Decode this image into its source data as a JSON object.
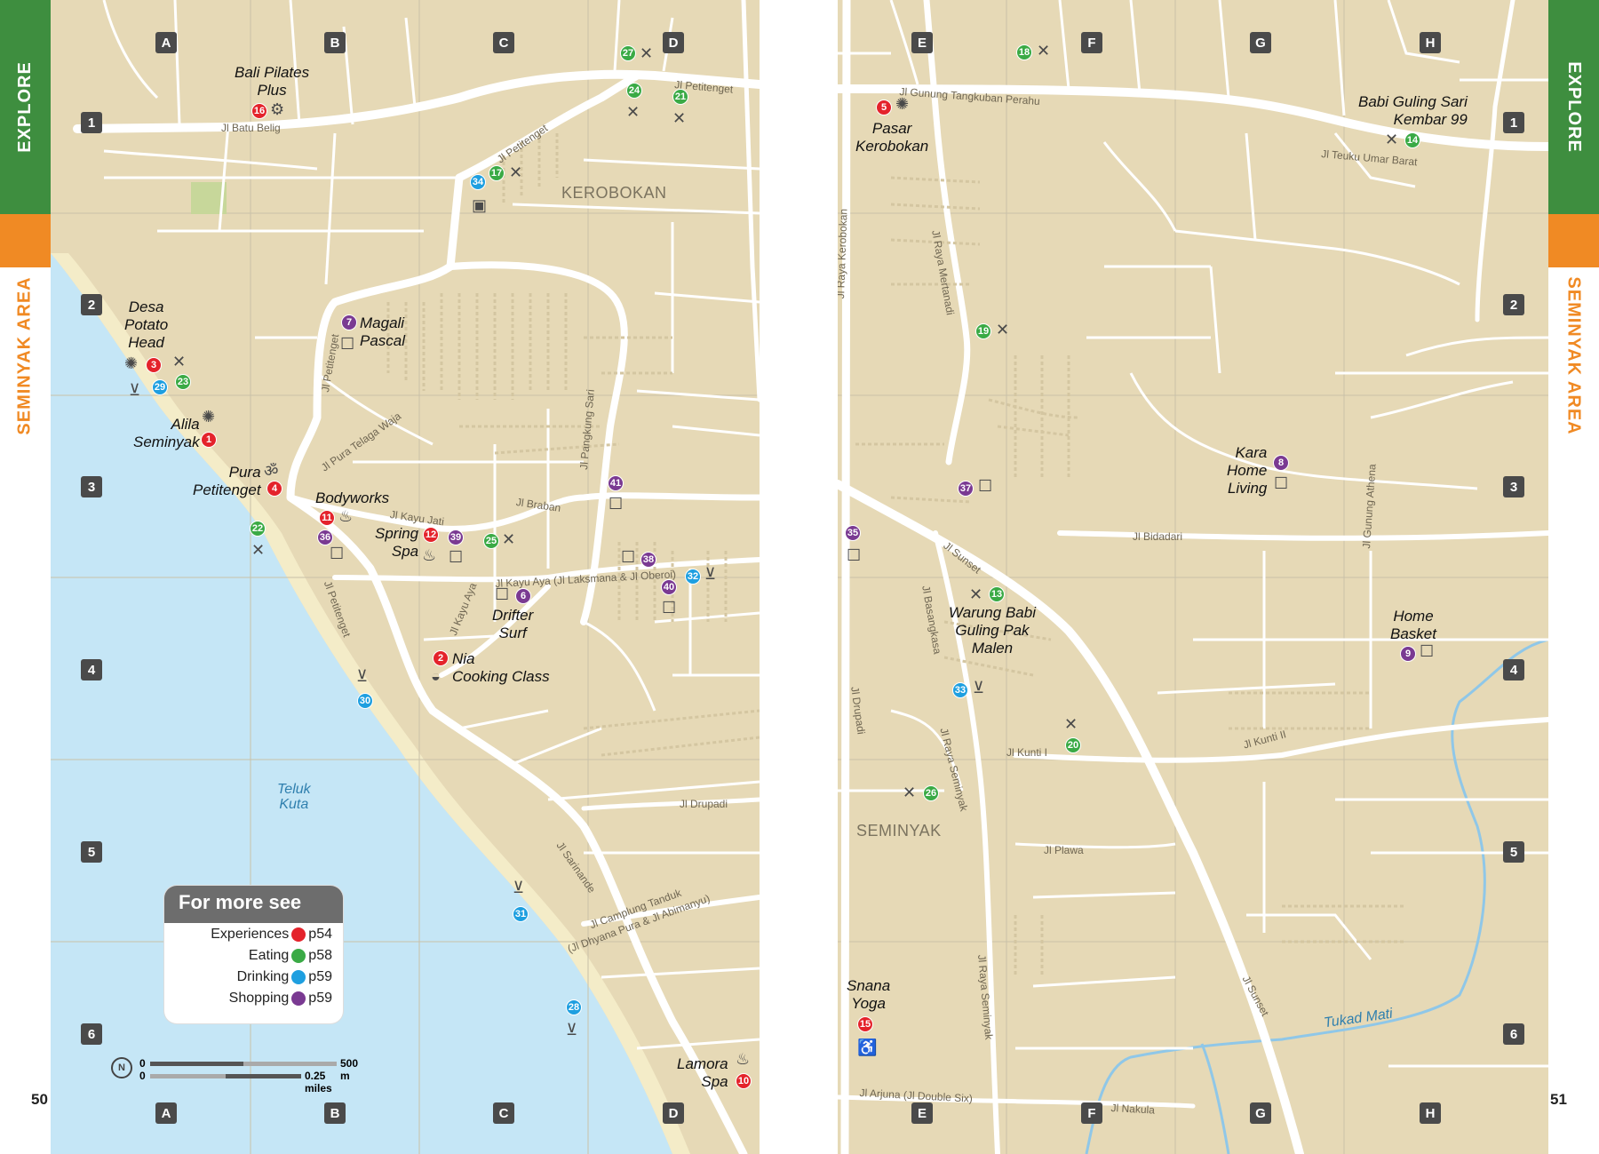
{
  "tabs": {
    "left_explore": "EXPLORE",
    "left_area": "SEMINYAK AREA",
    "right_explore": "EXPLORE",
    "right_area": "SEMINYAK AREA"
  },
  "page_numbers": {
    "left": "50",
    "right": "51"
  },
  "grid": {
    "left_cols": [
      "A",
      "B",
      "C",
      "D"
    ],
    "right_cols": [
      "E",
      "F",
      "G",
      "H"
    ],
    "rows": [
      "1",
      "2",
      "3",
      "4",
      "5",
      "6"
    ]
  },
  "area_labels": {
    "kerobokan": "KEROBOKAN",
    "seminyak": "SEMINYAK"
  },
  "water": {
    "teluk_kuta": "Teluk\nKuta",
    "tukad_mati": "Tukad Mati"
  },
  "streets": {
    "jl_batu_belig": "Jl Batu Belig",
    "jl_petitenget_top": "Jl Petitenget",
    "jl_petitenget_mid": "Jl Petitenget",
    "jl_petitenget_c2": "Jl Petitenget",
    "jl_petitenget_b4": "Jl Petitenget",
    "jl_pura_telaga_waja": "Jl Pura Telaga Waja",
    "jl_kayu_jati": "Jl Kayu Jati",
    "jl_braban": "Jl Braban",
    "jl_pangkung_sari": "Jl Pangkung Sari",
    "jl_kayu_aya_long": "Jl Kayu Aya (Jl Laksmana & Jl Oberoi)",
    "jl_kayu_aya": "Jl Kayu Aya",
    "jl_drupadi_left": "Jl Drupadi",
    "jl_sarinande": "Jl Sarinande",
    "jl_camplung": "Jl Camplung Tanduk",
    "jl_camplung2": "(Jl Dhyana Pura & Jl Abimanyu)",
    "jl_gunung_tangkuban": "Jl Gunung Tangkuban Perahu",
    "jl_teuku_umar": "Jl Teuku Umar Barat",
    "jl_raya_kerobokan": "Jl Raya Kerobokan",
    "jl_raya_mertanadi": "Jl Raya Mertanadi",
    "jl_sunset": "Jl Sunset",
    "jl_sunset2": "Jl Sunset",
    "jl_bidadari": "Jl Bidadari",
    "jl_gunung_athena": "Jl Gunung Athena",
    "jl_basangkasa": "Jl Basangkasa",
    "jl_drupadi_right": "Jl Drupadi",
    "jl_raya_seminyak": "Jl Raya Seminyak",
    "jl_raya_seminyak2": "Jl Raya Seminyak",
    "jl_kunti1": "Jl Kunti I",
    "jl_kunti2": "Jl Kunti II",
    "jl_plawa": "Jl Plawa",
    "jl_arjuna": "Jl Arjuna (Jl Double Six)",
    "jl_nakula": "Jl Nakula"
  },
  "places": [
    {
      "num": "16",
      "cat": "red",
      "label": "Bali Pilates\nPlus"
    },
    {
      "num": "27",
      "cat": "green",
      "label": ""
    },
    {
      "num": "24",
      "cat": "green",
      "label": ""
    },
    {
      "num": "21",
      "cat": "green",
      "label": ""
    },
    {
      "num": "17",
      "cat": "green",
      "label": ""
    },
    {
      "num": "34",
      "cat": "blue",
      "label": ""
    },
    {
      "num": "3",
      "cat": "red",
      "label": "Desa\nPotato\nHead"
    },
    {
      "num": "29",
      "cat": "blue",
      "label": ""
    },
    {
      "num": "23",
      "cat": "green",
      "label": ""
    },
    {
      "num": "7",
      "cat": "purple",
      "label": "Magali\nPascal"
    },
    {
      "num": "1",
      "cat": "red",
      "label": "Alila\nSeminyak"
    },
    {
      "num": "4",
      "cat": "red",
      "label": "Pura\nPetitenget"
    },
    {
      "num": "11",
      "cat": "red",
      "label": "Bodyworks"
    },
    {
      "num": "36",
      "cat": "purple",
      "label": ""
    },
    {
      "num": "22",
      "cat": "green",
      "label": ""
    },
    {
      "num": "12",
      "cat": "red",
      "label": "Spring\nSpa"
    },
    {
      "num": "39",
      "cat": "purple",
      "label": ""
    },
    {
      "num": "25",
      "cat": "green",
      "label": ""
    },
    {
      "num": "41",
      "cat": "purple",
      "label": ""
    },
    {
      "num": "38",
      "cat": "purple",
      "label": ""
    },
    {
      "num": "6",
      "cat": "purple",
      "label": "Drifter\nSurf"
    },
    {
      "num": "40",
      "cat": "purple",
      "label": ""
    },
    {
      "num": "32",
      "cat": "blue",
      "label": ""
    },
    {
      "num": "2",
      "cat": "red",
      "label": "Nia\nCooking Class"
    },
    {
      "num": "30",
      "cat": "blue",
      "label": ""
    },
    {
      "num": "31",
      "cat": "blue",
      "label": ""
    },
    {
      "num": "28",
      "cat": "blue",
      "label": ""
    },
    {
      "num": "10",
      "cat": "red",
      "label": "Lamora\nSpa"
    },
    {
      "num": "18",
      "cat": "green",
      "label": ""
    },
    {
      "num": "5",
      "cat": "red",
      "label": "Pasar\nKerobokan"
    },
    {
      "num": "14",
      "cat": "green",
      "label": "Babi Guling Sari\nKembar 99"
    },
    {
      "num": "19",
      "cat": "green",
      "label": ""
    },
    {
      "num": "37",
      "cat": "purple",
      "label": ""
    },
    {
      "num": "8",
      "cat": "purple",
      "label": "Kara\nHome\nLiving"
    },
    {
      "num": "35",
      "cat": "purple",
      "label": ""
    },
    {
      "num": "13",
      "cat": "green",
      "label": "Warung Babi\nGuling Pak\nMalen"
    },
    {
      "num": "33",
      "cat": "blue",
      "label": ""
    },
    {
      "num": "9",
      "cat": "purple",
      "label": "Home\nBasket"
    },
    {
      "num": "20",
      "cat": "green",
      "label": ""
    },
    {
      "num": "26",
      "cat": "green",
      "label": ""
    },
    {
      "num": "15",
      "cat": "red",
      "label": "Snana\nYoga"
    }
  ],
  "legend": {
    "title": "For more see",
    "rows": [
      {
        "name": "Experiences",
        "page": "p54",
        "color": "#e4232b"
      },
      {
        "name": "Eating",
        "page": "p58",
        "color": "#3aaa45"
      },
      {
        "name": "Drinking",
        "page": "p59",
        "color": "#1e9fe0"
      },
      {
        "name": "Shopping",
        "page": "p59",
        "color": "#7a3a92"
      }
    ]
  },
  "scale": {
    "zero1": "0",
    "zero2": "0",
    "km": "500 m",
    "miles": "0.25 miles",
    "north": "N"
  },
  "colors": {
    "land": "#e6d9b6",
    "sea": "#c5e6f6",
    "road": "#ffffff",
    "explore_green": "#3e8e3f",
    "area_orange": "#f08a24"
  }
}
